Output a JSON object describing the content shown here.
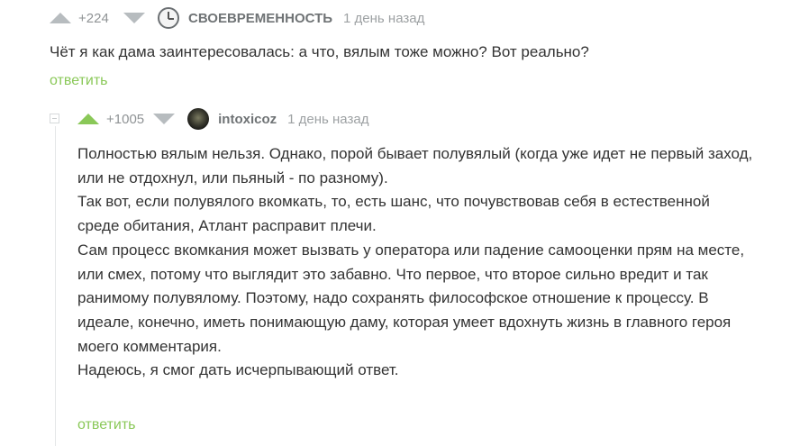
{
  "comments": [
    {
      "rating": "+224",
      "username": "СВОЕВРЕМЕННОСТЬ",
      "time": "1 день назад",
      "avatar_icon": "clock-icon",
      "lines": [
        "Чёт я как дама заинтересовалась: а что, вялым тоже можно? Вот реально?"
      ],
      "reply_label": "ответить"
    },
    {
      "rating": "+1005",
      "username": "intoxicoz",
      "time": "1 день назад",
      "avatar_icon": "user-photo-avatar",
      "upvoted": true,
      "lines": [
        "Полностью вялым нельзя. Однако, порой бывает полувялый (когда уже идет не первый заход,",
        "или не отдохнул, или пьяный - по разному).",
        "Так вот, если полувялого вкомкать, то, есть шанс, что почувствовав себя в естественной",
        "среде обитания, Атлант расправит плечи.",
        "Сам процесс вкомкания может вызвать у оператора или падение самооценки прям на месте,",
        "или смех, потому что выглядит это забавно. Что первое, что второе сильно вредит и так",
        "ранимому полувялому. Поэтому, надо сохранять философское отношение к процессу. В",
        "идеале, конечно, иметь понимающую даму, которая умеет вдохнуть жизнь в главного героя",
        "моего комментария.",
        "Надеюсь, я смог дать исчерпывающий ответ."
      ],
      "reply_label": "ответить"
    }
  ],
  "colors": {
    "upvote_active": "#8ac858",
    "vote_inactive": "#b7bcbf",
    "reply_link": "#8ac858",
    "text": "#333333"
  }
}
